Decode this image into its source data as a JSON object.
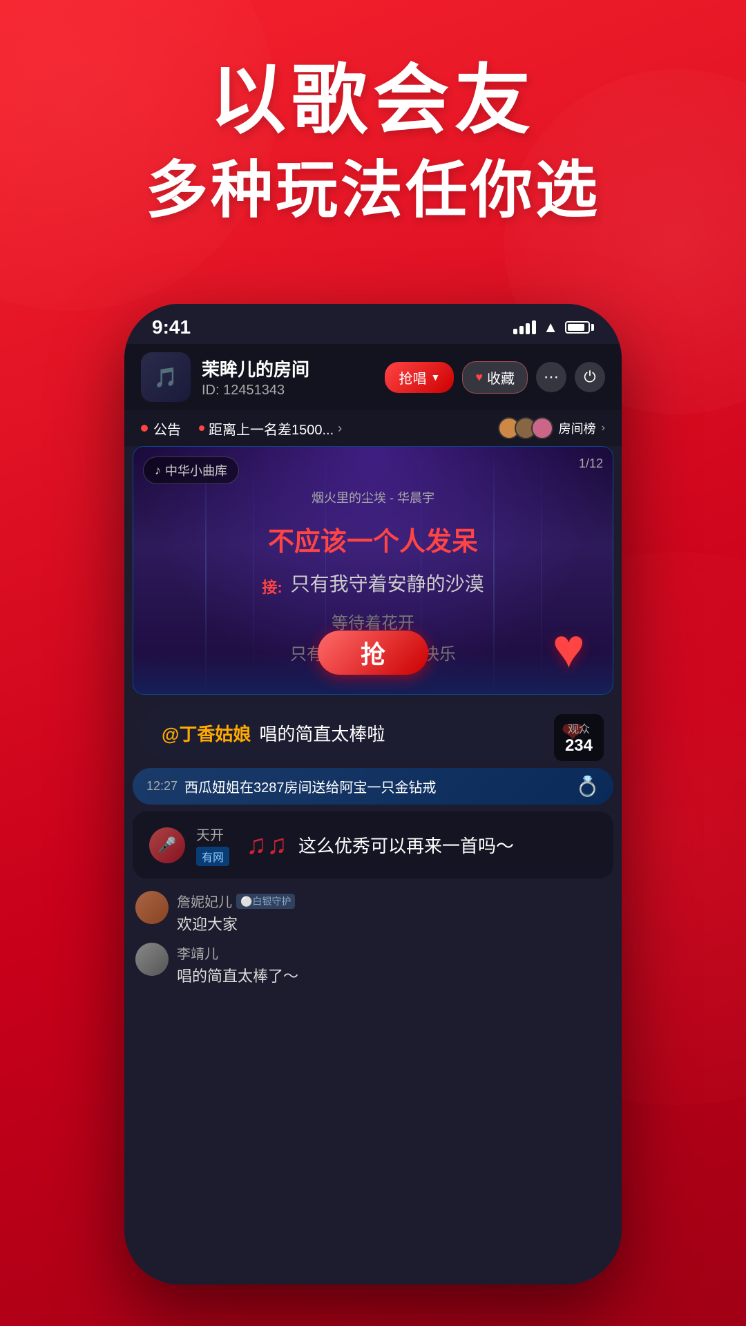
{
  "app": {
    "title": "以歌会友 多种玩法任你选",
    "hero_line1": "以歌会友",
    "hero_line2": "多种玩法任你选"
  },
  "status_bar": {
    "time": "9:41",
    "signal": "signal",
    "wifi": "wifi",
    "battery": "battery"
  },
  "room": {
    "name": "茉眸儿的房间",
    "id": "ID: 12451343",
    "btn_qiang": "抢唱",
    "btn_shoucang": "收藏",
    "avatar_emoji": "🎵"
  },
  "notice_bar": {
    "label": "公告",
    "text": "距离上一名差1500...",
    "arrow": ">",
    "rank_text": "房间榜",
    "rank_arrow": ">"
  },
  "karaoke": {
    "library_badge": "♪ 中华小曲库",
    "song_progress": "1/12",
    "song_title": "烟火里的尘埃 - 华晨宇",
    "lyric_current": "不应该一个人发呆",
    "lyric_next_label": "接:",
    "lyric_next": "只有我守着安静的沙漠",
    "lyric_line3": "等待着花开",
    "lyric_line4": "只有我看着别人的快乐",
    "grab_btn": "抢"
  },
  "comment": {
    "at_user": "@丁香姑娘",
    "text": " 唱的简直太棒啦",
    "heart": "❤"
  },
  "audience": {
    "label": "观众",
    "count": "234"
  },
  "gift": {
    "time": "12:27",
    "text1": "西瓜妞姐在3287房间送给阿宝一只金钻戒",
    "icon": "💍"
  },
  "music_suggestion": {
    "user_avatar": "🎤",
    "user_name": "天开",
    "user_tag": "有网",
    "notes": "♫♫",
    "text": "这么优秀可以再来一首吗～"
  },
  "chat_items": [
    {
      "username": "詹妮妃儿",
      "badge": "⚪白银守护",
      "message": "欢迎大家"
    },
    {
      "username": "李靖儿",
      "badge": "",
      "message": "唱的简直太棒了～"
    }
  ]
}
